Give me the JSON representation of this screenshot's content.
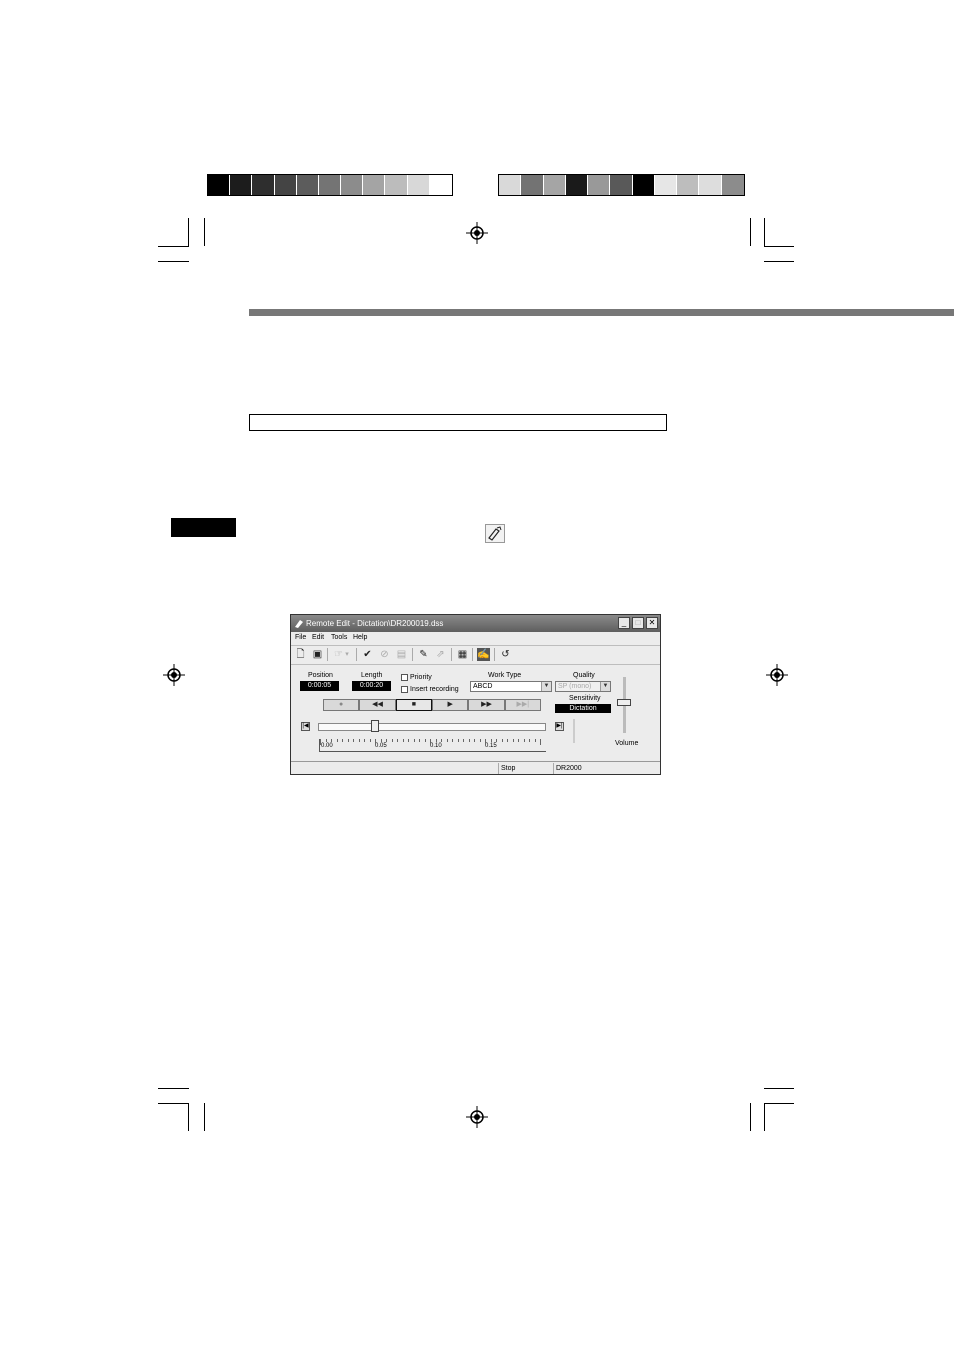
{
  "window": {
    "title": "Remote Edit - Dictation\\DR200019.dss",
    "minimize": "_",
    "maximize": "□",
    "close": "✕"
  },
  "menu": [
    "File",
    "Edit",
    "Tools",
    "Help"
  ],
  "toolbar_icons": [
    "new-icon",
    "save-icon",
    "hand-icon",
    "check-icon",
    "check-circle-icon",
    "book-icon",
    "eraser-icon",
    "export-icon",
    "properties-icon",
    "remote-edit-icon",
    "undo-icon"
  ],
  "toolbar_glyphs": {
    "new": "🗋",
    "save": "▣",
    "hand": "☞",
    "dropdown": "▾",
    "check": "✔",
    "check_circle": "⊘",
    "book": "▤",
    "eraser": "✎",
    "export": "⇗",
    "properties": "▦",
    "remote_edit": "✍",
    "undo": "↺"
  },
  "panel": {
    "position_label": "Position",
    "position_value": "0:00:05",
    "length_label": "Length",
    "length_value": "0:00:20",
    "priority_label": "Priority",
    "insert_label": "Insert recording",
    "worktype_label": "Work Type",
    "worktype_value": "ABCD",
    "quality_label": "Quality",
    "quality_value": "SP (mono)",
    "sensitivity_label": "Sensitivity",
    "sensitivity_value": "Dictation",
    "volume_label": "Volume",
    "volume_level": 0.55
  },
  "transport": {
    "record": "●",
    "rewind": "◀◀",
    "stop": "■",
    "play": "▶",
    "fast_forward": "▶▶",
    "end": "▶▶|"
  },
  "slider": {
    "start": "|◀",
    "end": "▶|",
    "position_fraction": 0.25,
    "ticks": [
      "0.00",
      "0.05",
      "0.10",
      "0.15"
    ]
  },
  "status": {
    "cell1": "",
    "cell2": "Stop",
    "cell3": "DR2000"
  },
  "colors": {
    "strip_left": [
      "#000000",
      "#1c1c1c",
      "#2e2e2e",
      "#444444",
      "#5c5c5c",
      "#747474",
      "#8c8c8c",
      "#a4a4a4",
      "#bcbcbc",
      "#d8d8d8",
      "#ffffff"
    ],
    "strip_right": [
      "#d9d9d9",
      "#737373",
      "#a5a5a5",
      "#1a1a1a",
      "#999999",
      "#595959",
      "#000000",
      "#e6e6e6",
      "#bdbdbd",
      "#dddddd",
      "#8c8c8c"
    ]
  }
}
